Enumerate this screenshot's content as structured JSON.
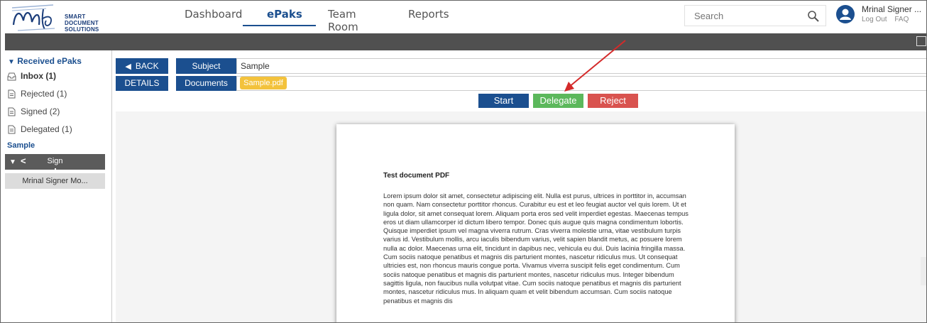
{
  "logo": {
    "text_line1": "SMART DOCUMENT",
    "text_line2": "SOLUTIONS"
  },
  "nav": {
    "items": [
      "Dashboard",
      "ePaks",
      "Team Room",
      "Reports"
    ],
    "active": "ePaks"
  },
  "search": {
    "placeholder": "Search",
    "icon": "search-icon"
  },
  "user": {
    "name": "Mrinal Signer ...",
    "logout": "Log Out",
    "faq": "FAQ"
  },
  "sidebar": {
    "heading": "Received ePaks",
    "items": [
      {
        "label": "Inbox (1)",
        "icon": "inbox-icon"
      },
      {
        "label": "Rejected (1)",
        "icon": "document-icon"
      },
      {
        "label": "Signed (2)",
        "icon": "document-icon"
      },
      {
        "label": "Delegated (1)",
        "icon": "document-icon"
      }
    ],
    "epak_name": "Sample",
    "step": "Sign",
    "signer": "Mrinal Signer Mo..."
  },
  "toolbar": {
    "back": "BACK",
    "details": "DETAILS",
    "subject_label": "Subject",
    "subject_value": "Sample",
    "documents_label": "Documents",
    "document_file": "Sample.pdf"
  },
  "actions": {
    "start": "Start",
    "delegate": "Delegate",
    "reject": "Reject"
  },
  "colors": {
    "primary": "#1b4f8f",
    "start": "#1b4f8f",
    "delegate": "#5cb85c",
    "reject": "#d9534f",
    "document_pill": "#f3c23c",
    "annotation_arrow": "#d42a2a"
  },
  "document": {
    "title": "Test document PDF",
    "body": "Lorem ipsum dolor sit amet, consectetur adipiscing elit. Nulla est purus, ultrices in porttitor in, accumsan non quam. Nam consectetur porttitor rhoncus. Curabitur eu est et leo feugiat auctor vel quis lorem. Ut et ligula dolor, sit amet consequat lorem. Aliquam porta eros sed velit imperdiet egestas. Maecenas tempus eros ut diam ullamcorper id dictum libero tempor. Donec quis augue quis magna condimentum lobortis. Quisque imperdiet ipsum vel magna viverra rutrum. Cras viverra molestie urna, vitae vestibulum turpis varius id. Vestibulum mollis, arcu iaculis bibendum varius, velit sapien blandit metus, ac posuere lorem nulla ac dolor. Maecenas urna elit, tincidunt in dapibus nec, vehicula eu dui. Duis lacinia fringilla massa. Cum sociis natoque penatibus et magnis dis parturient montes, nascetur ridiculus mus. Ut consequat ultricies est, non rhoncus mauris congue porta. Vivamus viverra suscipit felis eget condimentum. Cum sociis natoque penatibus et magnis dis parturient montes, nascetur ridiculus mus. Integer bibendum sagittis ligula, non faucibus nulla volutpat vitae. Cum sociis natoque penatibus et magnis dis parturient montes, nascetur ridiculus mus. In aliquam quam et velit bibendum accumsan. Cum sociis natoque penatibus et magnis dis"
  }
}
